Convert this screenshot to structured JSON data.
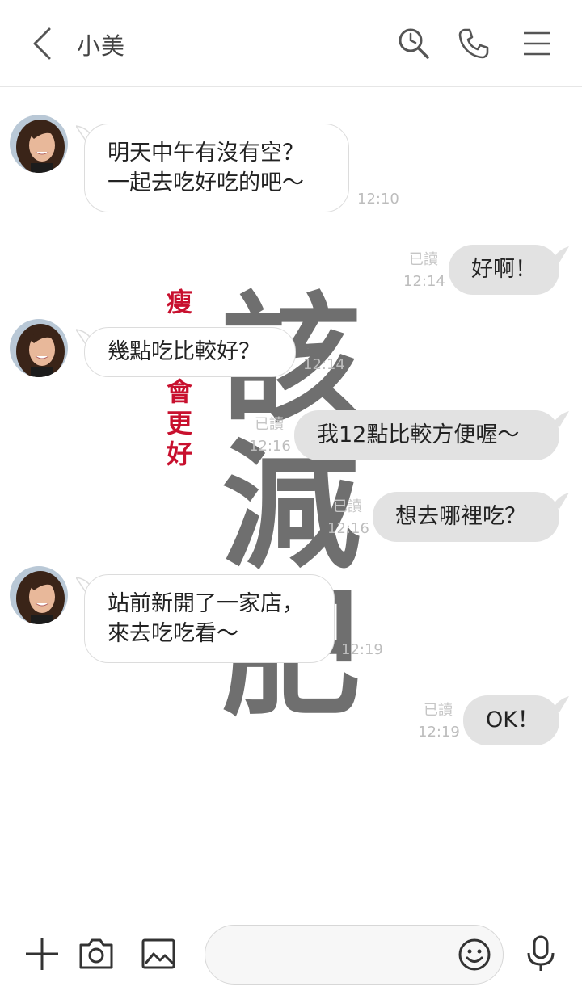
{
  "header": {
    "title": "小美",
    "back_icon": "chevron-left-icon",
    "search_icon": "clock-search-icon",
    "call_icon": "phone-icon",
    "menu_icon": "hamburger-menu-icon"
  },
  "wallpaper": {
    "big_chars": [
      "該",
      "減",
      "肥"
    ],
    "red_chars": [
      "瘦",
      "會",
      "更",
      "好"
    ],
    "red_color": "#c8102e",
    "big_color": "#6f6f6f"
  },
  "messages": [
    {
      "side": "in",
      "lines": [
        "明天中午有沒有空？",
        "一起去吃好吃的吧～"
      ],
      "time": "12:10"
    },
    {
      "side": "out",
      "text": "好啊！",
      "read": "已讀",
      "time": "12:14"
    },
    {
      "side": "in",
      "text": "幾點吃比較好？",
      "time": "12:14"
    },
    {
      "side": "out",
      "text": "我12點比較方便喔～",
      "read": "已讀",
      "time": "12:16"
    },
    {
      "side": "out",
      "text": "想去哪裡吃？",
      "read": "已讀",
      "time": "12:16"
    },
    {
      "side": "in",
      "lines": [
        "站前新開了一家店，",
        "來去吃吃看～"
      ],
      "time": "12:19"
    },
    {
      "side": "out",
      "text": "OK！",
      "read": "已讀",
      "time": "12:19"
    }
  ],
  "input_bar": {
    "placeholder": "",
    "plus_icon": "plus-icon",
    "camera_icon": "camera-icon",
    "image_icon": "image-icon",
    "emoji_icon": "smiley-icon",
    "mic_icon": "microphone-icon"
  }
}
